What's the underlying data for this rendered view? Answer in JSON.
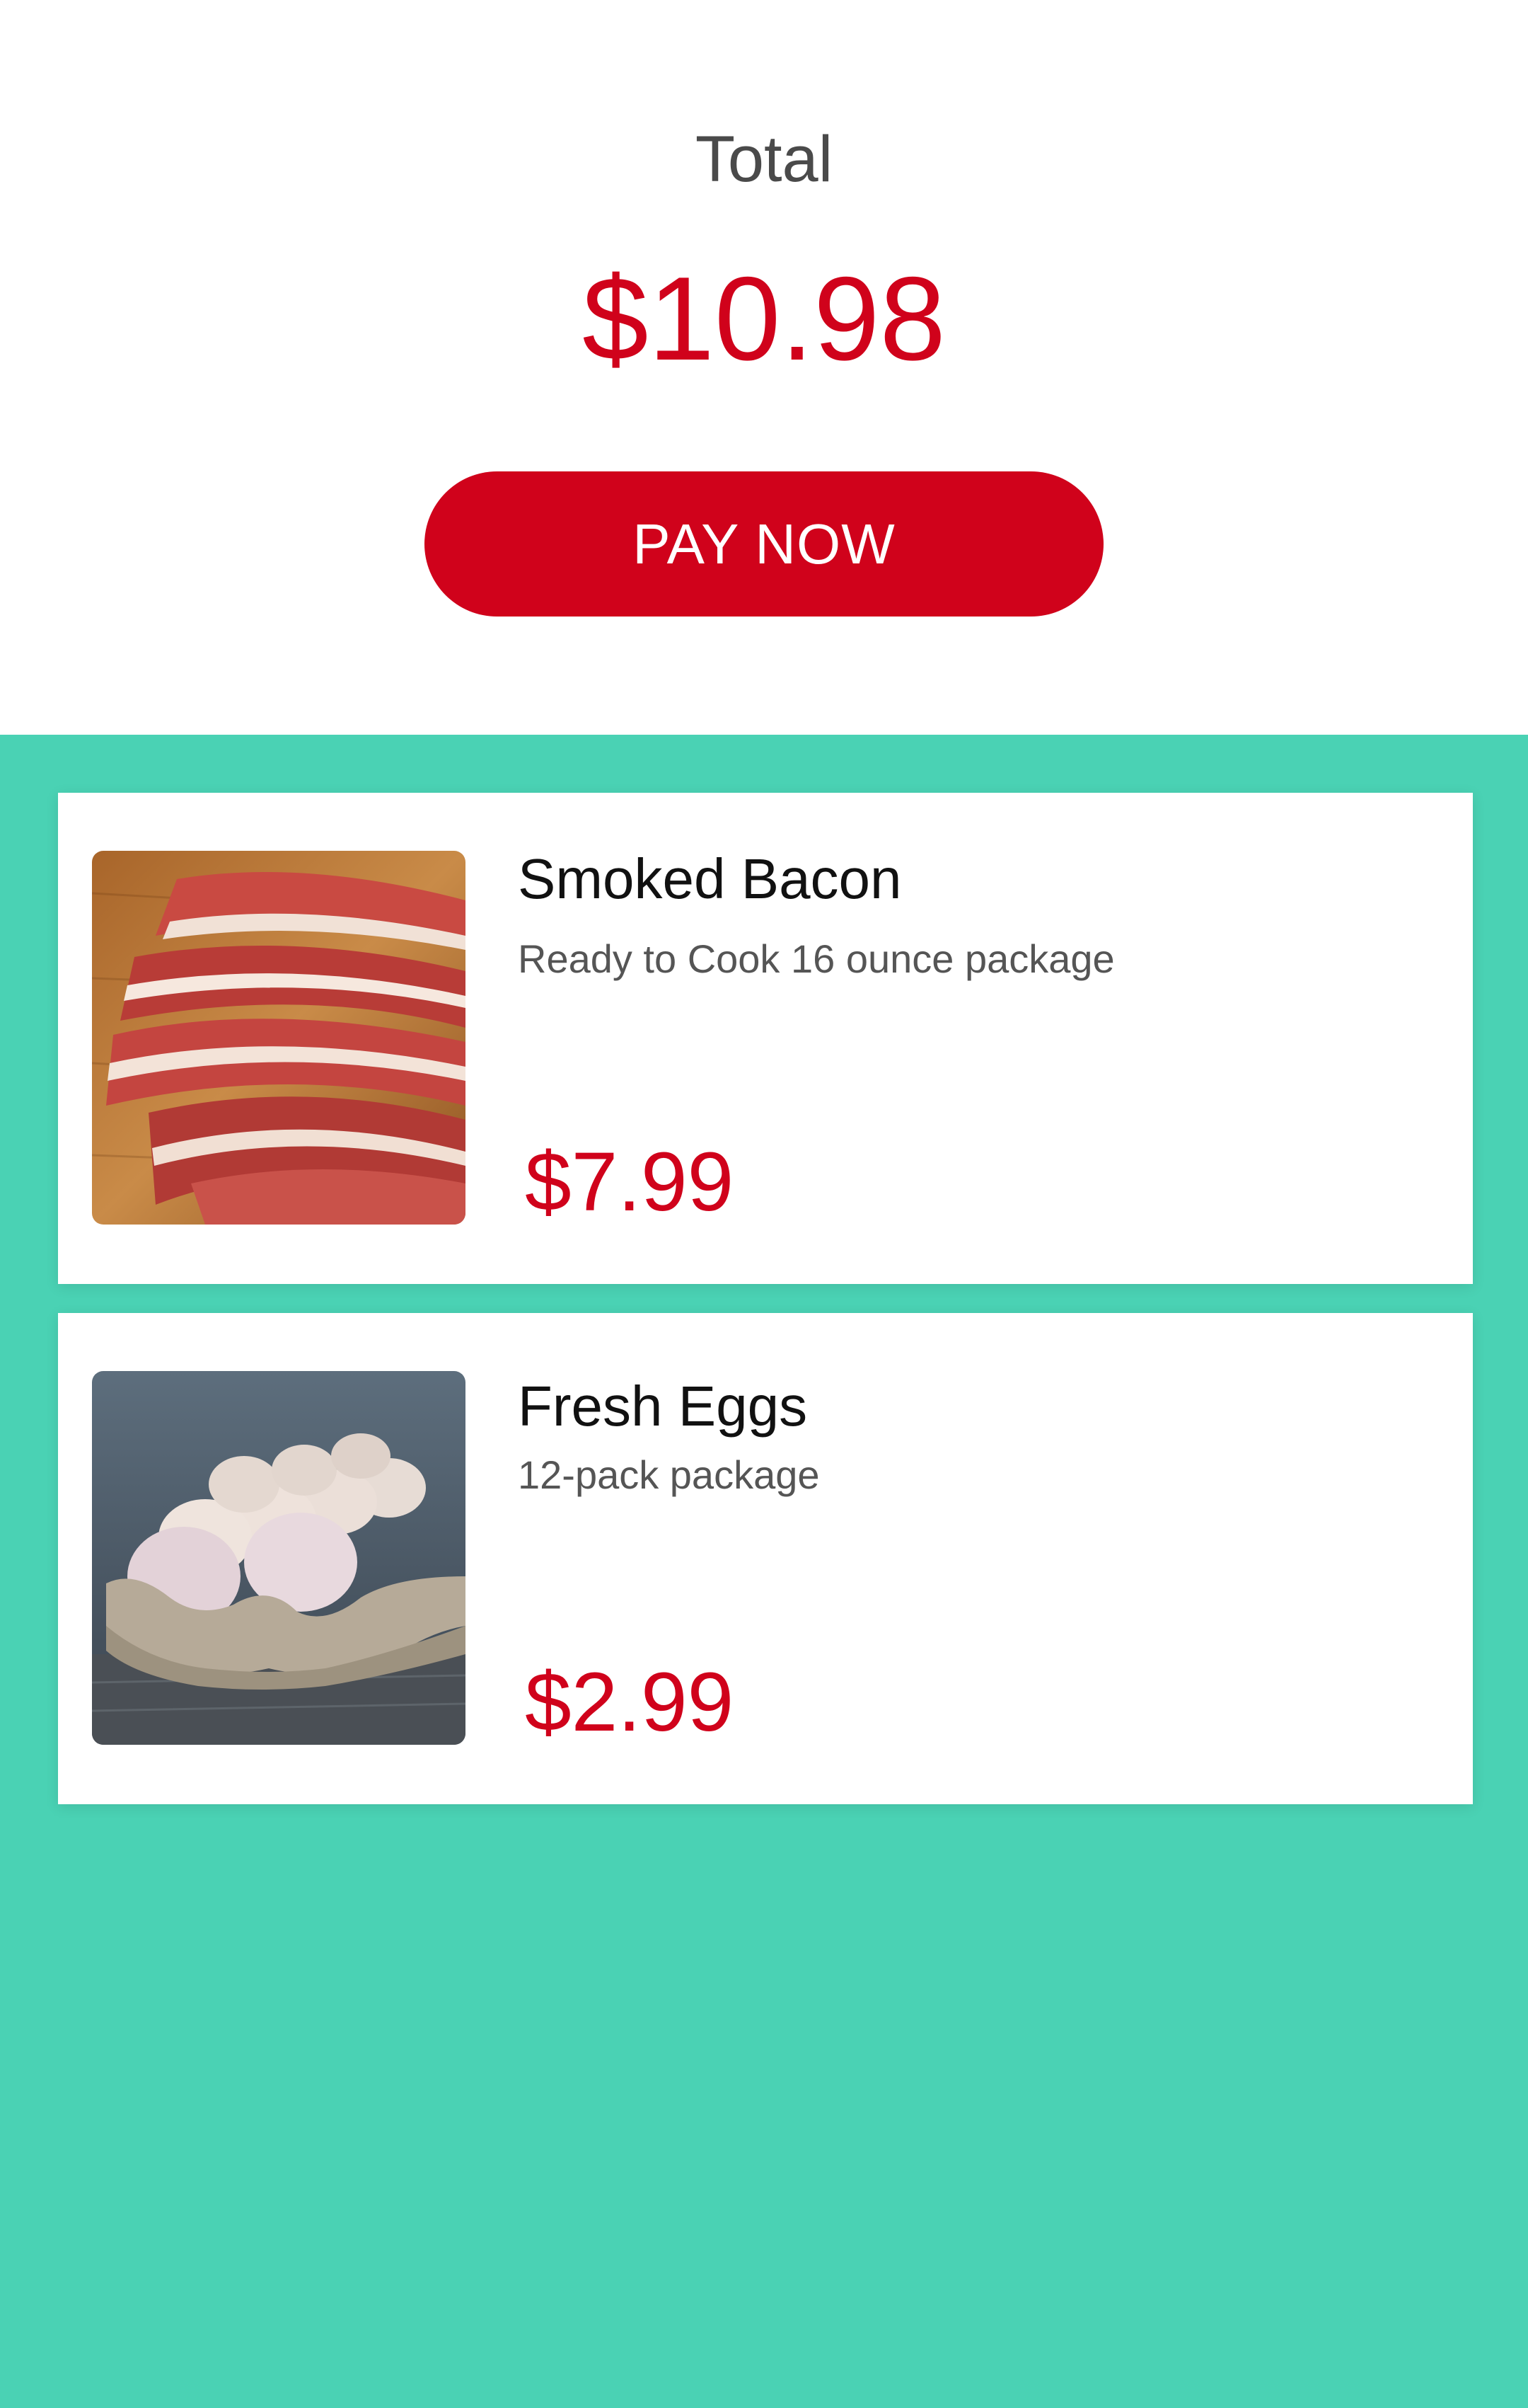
{
  "summary": {
    "total_label": "Total",
    "total_amount": "$10.98",
    "pay_button_label": "PAY NOW"
  },
  "items": [
    {
      "title": "Smoked Bacon",
      "description": "Ready to Cook 16 ounce package",
      "price": "$7.99",
      "image": "bacon-photo"
    },
    {
      "title": "Fresh Eggs",
      "description": "12-pack package",
      "price": "$2.99",
      "image": "eggs-photo"
    }
  ],
  "colors": {
    "accent": "#d0021b",
    "background": "#4ad2b4",
    "card": "#ffffff"
  }
}
